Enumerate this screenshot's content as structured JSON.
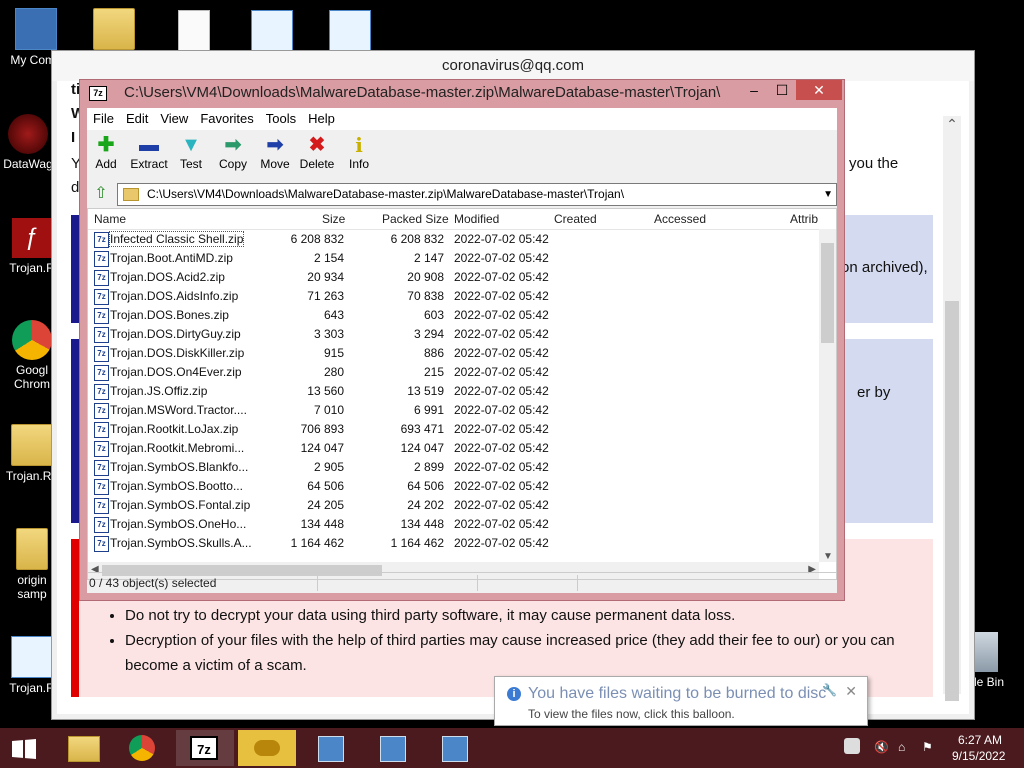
{
  "desktop_icons": [
    {
      "label": "My Comp",
      "icon": "computer-icon"
    },
    {
      "label": "DataWag",
      "icon": "datawag-icon"
    },
    {
      "label": "Trojan.R",
      "icon": "flash-icon"
    },
    {
      "label": "Googl\nChrom",
      "icon": "chrome-icon"
    },
    {
      "label": "Trojan.Ra",
      "icon": "folder-doc-icon"
    },
    {
      "label": "origin\nsamp",
      "icon": "folder-icon"
    },
    {
      "label": "Trojan.R",
      "icon": "document-icon"
    }
  ],
  "recycle_bin_label": "cle Bin",
  "note_window": {
    "title": "coronavirus@qq.com",
    "fragments": {
      "t1": "ti",
      "t2": "W",
      "t3": "I",
      "t4": "Y",
      "t5": "d",
      "right1": "you the",
      "right2": "on archived),",
      "right3": "er by"
    },
    "bullets": [
      "Do not try to decrypt your data using third party software, it may cause permanent data loss.",
      "Decryption of your files with the help of third parties may cause increased price (they add their fee to our) or you can become a victim of a scam."
    ]
  },
  "sevenzip": {
    "title": "C:\\Users\\VM4\\Downloads\\MalwareDatabase-master.zip\\MalwareDatabase-master\\Trojan\\",
    "app_icon_text": "7z",
    "window_buttons": {
      "minimize": "–",
      "maximize": "☐",
      "close": "✕"
    },
    "menu": [
      "File",
      "Edit",
      "View",
      "Favorites",
      "Tools",
      "Help"
    ],
    "toolbar": [
      {
        "label": "Add",
        "icon": "add-icon",
        "glyph": "✚",
        "color": "#1aa61a"
      },
      {
        "label": "Extract",
        "icon": "extract-icon",
        "glyph": "▬",
        "color": "#1f3fa8"
      },
      {
        "label": "Test",
        "icon": "test-icon",
        "glyph": "▼",
        "color": "#2ab4c0"
      },
      {
        "label": "Copy",
        "icon": "copy-icon",
        "glyph": "➡",
        "color": "#2a9a6a"
      },
      {
        "label": "Move",
        "icon": "move-icon",
        "glyph": "➡",
        "color": "#1f3fa8"
      },
      {
        "label": "Delete",
        "icon": "delete-icon",
        "glyph": "✖",
        "color": "#d41a1a"
      },
      {
        "label": "Info",
        "icon": "info-icon",
        "glyph": "i",
        "color": "#c8b000"
      }
    ],
    "address": "C:\\Users\\VM4\\Downloads\\MalwareDatabase-master.zip\\MalwareDatabase-master\\Trojan\\",
    "columns": [
      "Name",
      "Size",
      "Packed Size",
      "Modified",
      "Created",
      "Accessed",
      "Attrib"
    ],
    "files": [
      {
        "name": "Infected Classic Shell.zip",
        "size": "6 208 832",
        "packed": "6 208 832",
        "modified": "2022-07-02 05:42"
      },
      {
        "name": "Trojan.Boot.AntiMD.zip",
        "size": "2 154",
        "packed": "2 147",
        "modified": "2022-07-02 05:42"
      },
      {
        "name": "Trojan.DOS.Acid2.zip",
        "size": "20 934",
        "packed": "20 908",
        "modified": "2022-07-02 05:42"
      },
      {
        "name": "Trojan.DOS.AidsInfo.zip",
        "size": "71 263",
        "packed": "70 838",
        "modified": "2022-07-02 05:42"
      },
      {
        "name": "Trojan.DOS.Bones.zip",
        "size": "643",
        "packed": "603",
        "modified": "2022-07-02 05:42"
      },
      {
        "name": "Trojan.DOS.DirtyGuy.zip",
        "size": "3 303",
        "packed": "3 294",
        "modified": "2022-07-02 05:42"
      },
      {
        "name": "Trojan.DOS.DiskKiller.zip",
        "size": "915",
        "packed": "886",
        "modified": "2022-07-02 05:42"
      },
      {
        "name": "Trojan.DOS.On4Ever.zip",
        "size": "280",
        "packed": "215",
        "modified": "2022-07-02 05:42"
      },
      {
        "name": "Trojan.JS.Offiz.zip",
        "size": "13 560",
        "packed": "13 519",
        "modified": "2022-07-02 05:42"
      },
      {
        "name": "Trojan.MSWord.Tractor....",
        "size": "7 010",
        "packed": "6 991",
        "modified": "2022-07-02 05:42"
      },
      {
        "name": "Trojan.Rootkit.LoJax.zip",
        "size": "706 893",
        "packed": "693 471",
        "modified": "2022-07-02 05:42"
      },
      {
        "name": "Trojan.Rootkit.Mebromi...",
        "size": "124 047",
        "packed": "124 047",
        "modified": "2022-07-02 05:42"
      },
      {
        "name": "Trojan.SymbOS.Blankfo...",
        "size": "2 905",
        "packed": "2 899",
        "modified": "2022-07-02 05:42"
      },
      {
        "name": "Trojan.SymbOS.Bootto...",
        "size": "64 506",
        "packed": "64 506",
        "modified": "2022-07-02 05:42"
      },
      {
        "name": "Trojan.SymbOS.Fontal.zip",
        "size": "24 205",
        "packed": "24 202",
        "modified": "2022-07-02 05:42"
      },
      {
        "name": "Trojan.SymbOS.OneHo...",
        "size": "134 448",
        "packed": "134 448",
        "modified": "2022-07-02 05:42"
      },
      {
        "name": "Trojan.SymbOS.Skulls.A...",
        "size": "1 164 462",
        "packed": "1 164 462",
        "modified": "2022-07-02 05:42"
      }
    ],
    "status": "0 / 43 object(s) selected"
  },
  "balloon": {
    "title": "You have files waiting to be burned to disc",
    "subtitle": "To view the files now, click this balloon.",
    "close": "✕"
  },
  "taskbar": {
    "apps": [
      "start-icon",
      "file-explorer-icon",
      "chrome-icon",
      "7zip-icon",
      "handshake-icon",
      "installer-icon",
      "installer-icon",
      "installer-icon"
    ],
    "time": "6:27 AM",
    "date": "9/15/2022"
  }
}
